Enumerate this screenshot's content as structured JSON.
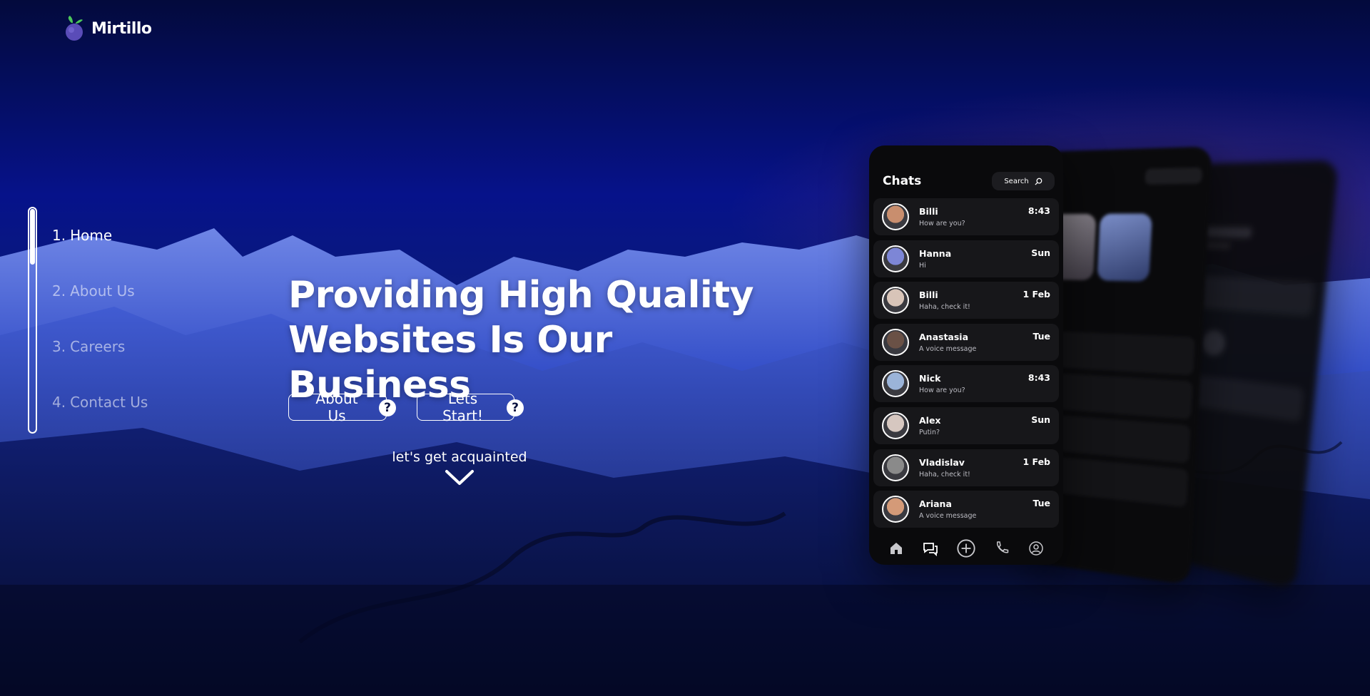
{
  "brand": {
    "name": "Mirtillo"
  },
  "nav": {
    "items": [
      {
        "num": "1.",
        "label": "Home",
        "active": true
      },
      {
        "num": "2.",
        "label": "About Us",
        "active": false
      },
      {
        "num": "3.",
        "label": "Careers",
        "active": false
      },
      {
        "num": "4.",
        "label": "Contact Us",
        "active": false
      }
    ]
  },
  "hero": {
    "title": "Providing High Quality\nWebsites Is Our Business",
    "buttons": {
      "about": "About Us",
      "start": "Lets Start!",
      "help_glyph": "?"
    },
    "scroll_hint": "let's get acquainted"
  },
  "phone": {
    "title": "Chats",
    "search": "Search",
    "chats": [
      {
        "name": "Billi",
        "message": "How are you?",
        "time": "8:43",
        "color": "#c98e6e"
      },
      {
        "name": "Hanna",
        "message": "Hi",
        "time": "Sun",
        "color": "#7d86d6"
      },
      {
        "name": "Billi",
        "message": "Haha, check it!",
        "time": "1 Feb",
        "color": "#d8c4b8"
      },
      {
        "name": "Anastasia",
        "message": "A voice message",
        "time": "Tue",
        "color": "#6a5146"
      },
      {
        "name": "Nick",
        "message": "How are you?",
        "time": "8:43",
        "color": "#9bb4d9"
      },
      {
        "name": "Alex",
        "message": "Putin?",
        "time": "Sun",
        "color": "#d6c7c0"
      },
      {
        "name": "Vladislav",
        "message": "Haha, check it!",
        "time": "1 Feb",
        "color": "#8a8a8a"
      },
      {
        "name": "Ariana",
        "message": "A voice message",
        "time": "Tue",
        "color": "#d49a78"
      }
    ],
    "tabs": [
      "home-icon",
      "chat-icon",
      "plus-icon",
      "phone-icon",
      "profile-icon"
    ]
  },
  "colors": {
    "accent_blue": "#06128a",
    "phone_bg": "#0a0a0c",
    "row_bg": "#17171a"
  }
}
